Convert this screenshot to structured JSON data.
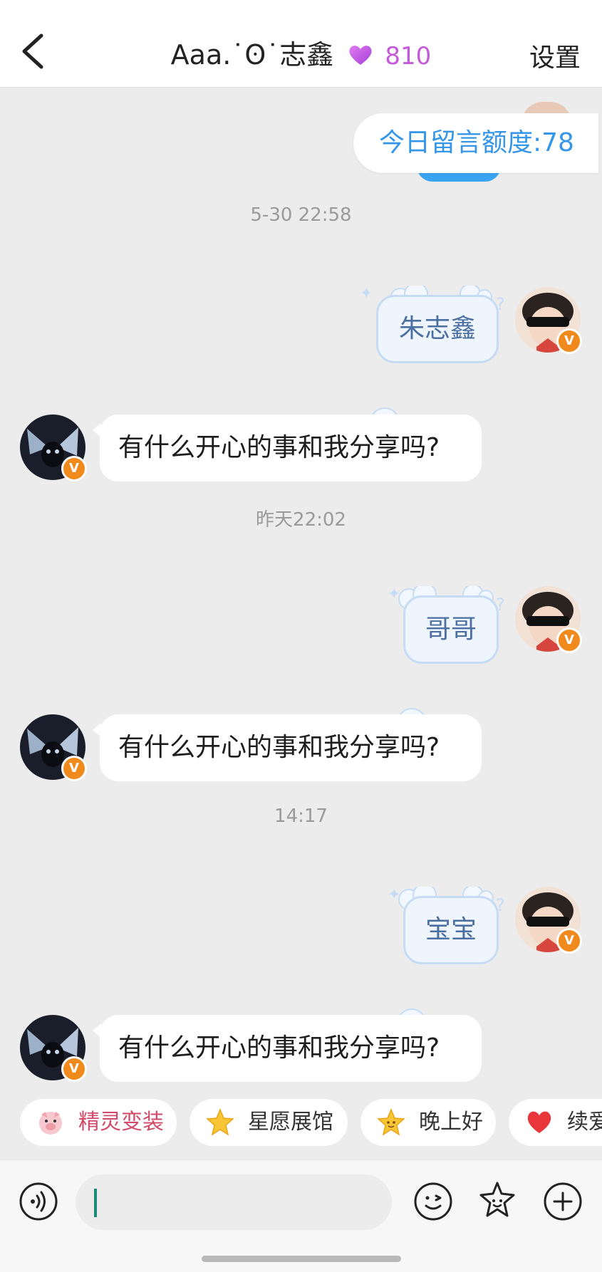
{
  "header": {
    "back_icon": "chevron-left-icon",
    "title": "Aaa.˙ʘ˙志鑫",
    "heart_icon": "purple-heart-icon",
    "intimacy_score": "810",
    "settings_label": "设置"
  },
  "quota": {
    "text": "今日留言额度:78"
  },
  "messages": [
    {
      "time": "5-30 22:58",
      "outgoing_text": "朱志鑫",
      "incoming_text": "有什么开心的事和我分享吗?"
    },
    {
      "time": "昨天22:02",
      "outgoing_text": "哥哥",
      "incoming_text": "有什么开心的事和我分享吗?"
    },
    {
      "time": "14:17",
      "outgoing_text": "宝宝",
      "incoming_text": "有什么开心的事和我分享吗?"
    }
  ],
  "badge_label": "V",
  "quick_chips": [
    {
      "label": "精灵变装",
      "icon": "pig-sprite-icon"
    },
    {
      "label": "星愿展馆",
      "icon": "star-icon"
    },
    {
      "label": "晚上好",
      "icon": "star-face-icon"
    },
    {
      "label": "续爱",
      "icon": "heart-icon"
    }
  ],
  "input_bar": {
    "voice_icon": "voice-icon",
    "emoji_icon": "emoji-icon",
    "sticker_icon": "sticker-star-icon",
    "plus_icon": "plus-icon",
    "value": ""
  },
  "colors": {
    "accent_blue": "#3596e8",
    "score_purple": "#c45ad9",
    "badge_orange": "#f08a1c",
    "background": "#ececec"
  }
}
